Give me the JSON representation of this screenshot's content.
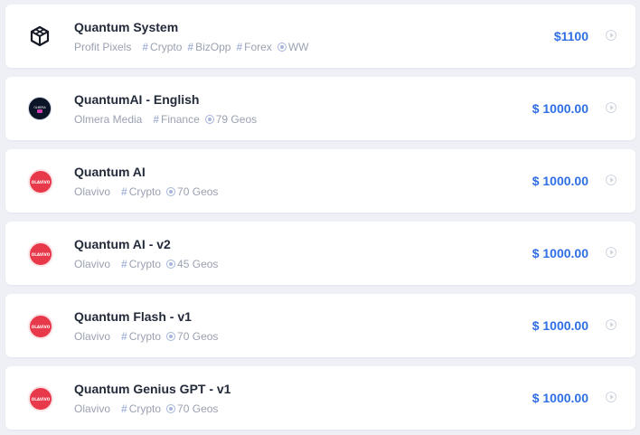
{
  "offers": [
    {
      "logo": "cube-logo",
      "logo_style": "cube",
      "title": "Quantum System",
      "company": "Profit Pixels",
      "tags": [
        "Crypto",
        "BizOpp",
        "Forex"
      ],
      "geo": "WW",
      "price": "$1100"
    },
    {
      "logo": "olmera-logo",
      "logo_style": "dark",
      "logo_text": "OLMERA",
      "title": "QuantumAI - English",
      "company": "Olmera Media",
      "tags": [
        "Finance"
      ],
      "geo": "79 Geos",
      "price": "$ 1000.00"
    },
    {
      "logo": "olavivo-logo",
      "logo_style": "red",
      "logo_text": "OLAVIVO",
      "title": "Quantum AI",
      "company": "Olavivo",
      "tags": [
        "Crypto"
      ],
      "geo": "70 Geos",
      "price": "$ 1000.00"
    },
    {
      "logo": "olavivo-logo",
      "logo_style": "red",
      "logo_text": "OLAVIVO",
      "title": "Quantum AI - v2",
      "company": "Olavivo",
      "tags": [
        "Crypto"
      ],
      "geo": "45 Geos",
      "price": "$ 1000.00"
    },
    {
      "logo": "olavivo-logo",
      "logo_style": "red",
      "logo_text": "OLAVIVO",
      "title": "Quantum Flash - v1",
      "company": "Olavivo",
      "tags": [
        "Crypto"
      ],
      "geo": "70 Geos",
      "price": "$ 1000.00"
    },
    {
      "logo": "olavivo-logo",
      "logo_style": "red",
      "logo_text": "OLAVIVO",
      "title": "Quantum Genius GPT - v1",
      "company": "Olavivo",
      "tags": [
        "Crypto"
      ],
      "geo": "70 Geos",
      "price": "$ 1000.00"
    }
  ],
  "icons": {
    "tag": "hash-icon",
    "geo": "location-icon",
    "action": "play-circle-icon"
  },
  "colors": {
    "price": "#2f6fe4",
    "title": "#232a3a",
    "meta": "#9aa1b1",
    "icon_accent": "#a7b6da",
    "olavivo_red": "#e8394a"
  }
}
